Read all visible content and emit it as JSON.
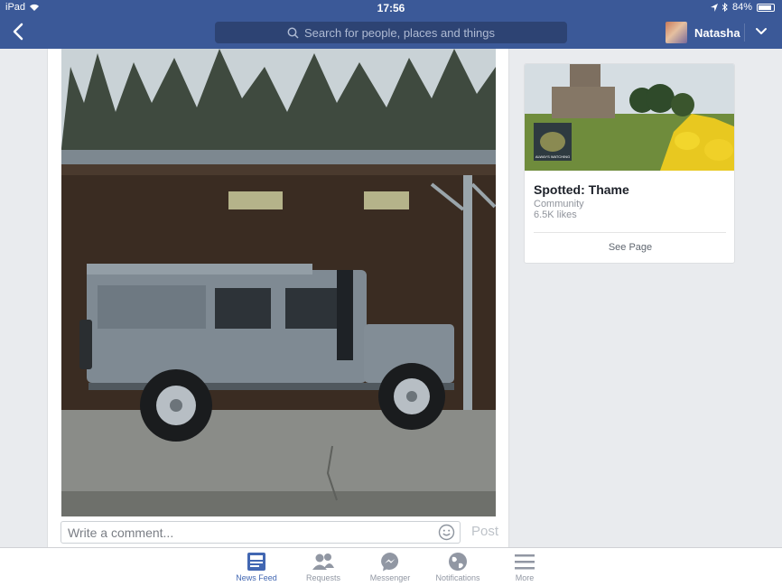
{
  "status_bar": {
    "device": "iPad",
    "time": "17:56",
    "battery": "84%"
  },
  "nav": {
    "search_placeholder": "Search for people, places and things",
    "user_name": "Natasha"
  },
  "post": {
    "comment_placeholder": "Write a comment...",
    "post_label": "Post"
  },
  "page_card": {
    "badge_text": "ALWAYS WATCHING",
    "name": "Spotted: Thame",
    "category": "Community",
    "likes": "6.5K likes",
    "see_page": "See Page"
  },
  "tabs": [
    {
      "label": "News Feed",
      "icon": "news-feed-icon",
      "active": true
    },
    {
      "label": "Requests",
      "icon": "friend-requests-icon",
      "active": false
    },
    {
      "label": "Messenger",
      "icon": "messenger-icon",
      "active": false
    },
    {
      "label": "Notifications",
      "icon": "globe-icon",
      "active": false
    },
    {
      "label": "More",
      "icon": "hamburger-icon",
      "active": false
    }
  ],
  "colors": {
    "brand": "#3b5998",
    "active_tab": "#4267b2"
  }
}
